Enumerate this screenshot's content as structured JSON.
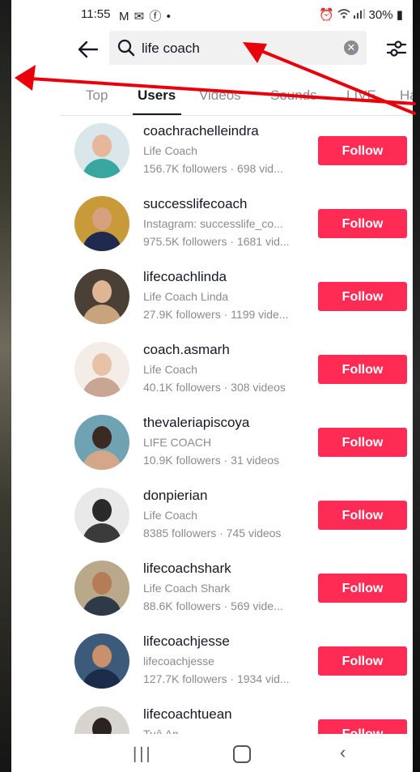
{
  "status_bar": {
    "time": "11:55",
    "left_icons": "M ✉ ⓕ •",
    "right_text": "30%"
  },
  "search": {
    "query": "life coach",
    "placeholder": "Search",
    "clear_icon": "clear-icon"
  },
  "tabs": [
    {
      "label": "Top",
      "active": false
    },
    {
      "label": "Users",
      "active": true
    },
    {
      "label": "Videos",
      "active": false
    },
    {
      "label": "Sounds",
      "active": false
    },
    {
      "label": "LIVE",
      "active": false
    },
    {
      "label": "Ha",
      "active": false
    }
  ],
  "follow_label": "Follow",
  "users": [
    {
      "username": "coachrachelleindra",
      "subtitle": "Life Coach",
      "stats": "156.7K followers · 698 vid..."
    },
    {
      "username": "successlifecoach",
      "subtitle": "Instagram: successlife_co...",
      "stats": "975.5K followers · 1681 vid..."
    },
    {
      "username": "lifecoachlinda",
      "subtitle": "Life Coach Linda",
      "stats": "27.9K followers · 1199 vide..."
    },
    {
      "username": "coach.asmarh",
      "subtitle": "Life Coach",
      "stats": "40.1K followers · 308 videos"
    },
    {
      "username": "thevaleriapiscoya",
      "subtitle": "LIFE COACH",
      "stats": "10.9K followers · 31 videos"
    },
    {
      "username": "donpierian",
      "subtitle": "Life Coach",
      "stats": "8385 followers · 745 videos"
    },
    {
      "username": "lifecoachshark",
      "subtitle": "Life Coach Shark",
      "stats": "88.6K followers · 569 vide..."
    },
    {
      "username": "lifecoachjesse",
      "subtitle": "lifecoachjesse",
      "stats": "127.7K followers · 1934 vid..."
    },
    {
      "username": "lifecoachtuean",
      "subtitle": "Tuệ An",
      "stats": ""
    }
  ],
  "colors": {
    "follow_button": "#fe2c55",
    "annotation_arrow": "#e8000b"
  }
}
